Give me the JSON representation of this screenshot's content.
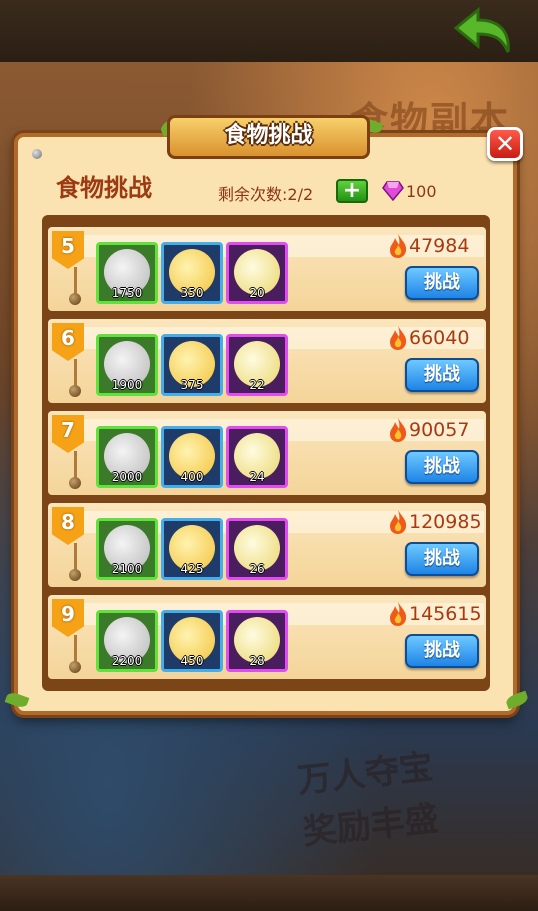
{
  "dialog": {
    "banner_title": "食物挑战",
    "panel_title": "食物挑战",
    "remaining_label": "剩余次数:2/2",
    "plus_label": "+",
    "close_label": "✕",
    "gem_count": "100"
  },
  "background": {
    "scene_title": "食物副本",
    "promo_line1": "万人夺宝",
    "promo_line2": "奖励丰盛"
  },
  "challenge_label": "挑战",
  "rows": [
    {
      "level": "5",
      "power": "47984",
      "items": [
        "1750",
        "350",
        "20"
      ]
    },
    {
      "level": "6",
      "power": "66040",
      "items": [
        "1900",
        "375",
        "22"
      ]
    },
    {
      "level": "7",
      "power": "90057",
      "items": [
        "2000",
        "400",
        "24"
      ]
    },
    {
      "level": "8",
      "power": "120985",
      "items": [
        "2100",
        "425",
        "26"
      ]
    },
    {
      "level": "9",
      "power": "145615",
      "items": [
        "2200",
        "450",
        "28"
      ]
    }
  ],
  "item_icons": [
    "tofu-icon",
    "fried-tofu-icon",
    "rice-bowl-icon"
  ],
  "colors": {
    "frame": "#b06a2c",
    "accent_green": "#5fe23b",
    "accent_blue": "#42aeea",
    "accent_purple": "#e14cf0",
    "button_blue": "#1e84e6",
    "close_red": "#c81c12"
  }
}
